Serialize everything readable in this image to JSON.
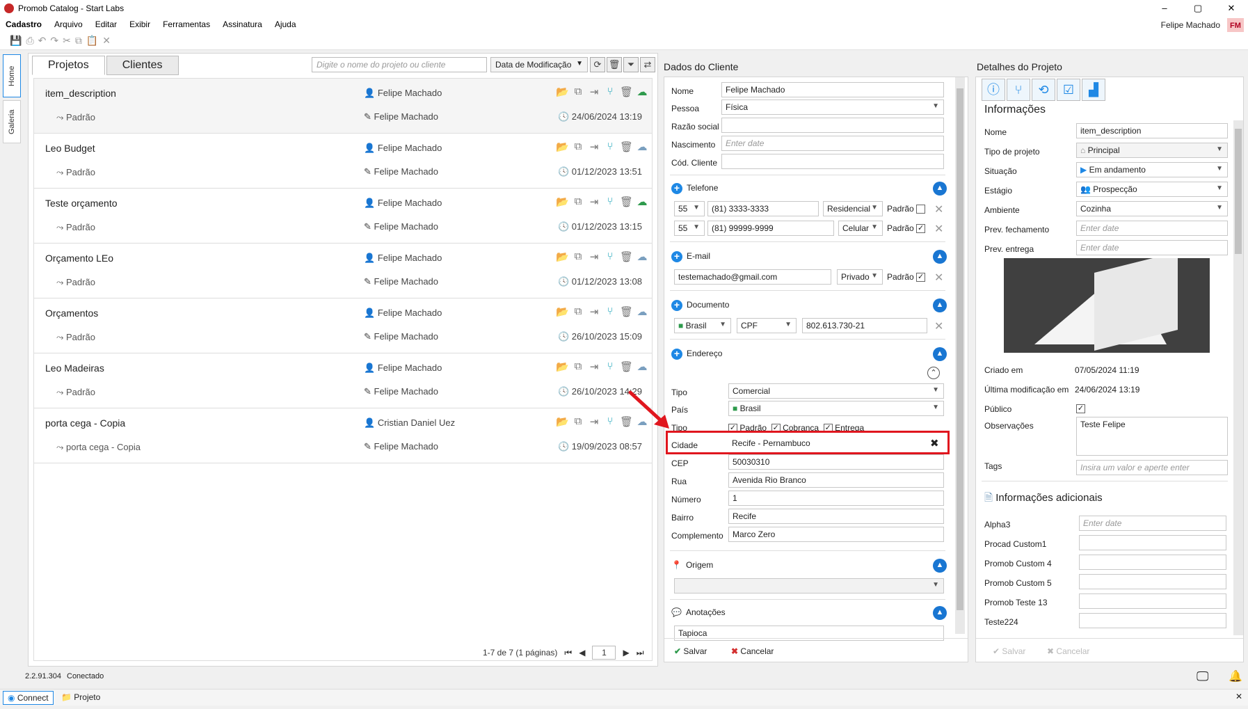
{
  "window": {
    "title": "Promob Catalog - Start Labs",
    "min": "–",
    "max": "▢",
    "close": "✕"
  },
  "menu": [
    "Cadastro",
    "Arquivo",
    "Editar",
    "Exibir",
    "Ferramentas",
    "Assinatura",
    "Ajuda"
  ],
  "user": {
    "name": "Felipe Machado",
    "initials": "FM"
  },
  "sidetabs": [
    "Home",
    "Galeria"
  ],
  "tabs": [
    "Projetos",
    "Clientes"
  ],
  "search": {
    "placeholder": "Digite o nome do projeto ou cliente"
  },
  "sort": {
    "value": "Data de Modificação"
  },
  "projects": [
    {
      "name": "item_description",
      "variant": "Padrão",
      "user": "Felipe Machado",
      "modified_by": "Felipe Machado",
      "date": "24/06/2024 13:19",
      "cloud": "green"
    },
    {
      "name": "Leo Budget",
      "variant": "Padrão",
      "user": "Felipe Machado",
      "modified_by": "Felipe Machado",
      "date": "01/12/2023 13:51",
      "cloud": "blue"
    },
    {
      "name": "Teste orçamento",
      "variant": "Padrão",
      "user": "Felipe Machado",
      "modified_by": "Felipe Machado",
      "date": "01/12/2023 13:15",
      "cloud": "green"
    },
    {
      "name": "Orçamento LEo",
      "variant": "Padrão",
      "user": "Felipe Machado",
      "modified_by": "Felipe Machado",
      "date": "01/12/2023 13:08",
      "cloud": "blue"
    },
    {
      "name": "Orçamentos",
      "variant": "Padrão",
      "user": "Felipe Machado",
      "modified_by": "Felipe Machado",
      "date": "26/10/2023 15:09",
      "cloud": "blue"
    },
    {
      "name": "Leo Madeiras",
      "variant": "Padrão",
      "user": "Felipe Machado",
      "modified_by": "Felipe Machado",
      "date": "26/10/2023 14:29",
      "cloud": "blue"
    },
    {
      "name": "porta cega - Copia",
      "variant": "porta cega - Copia",
      "user": "Cristian Daniel Uez",
      "modified_by": "Felipe Machado",
      "date": "19/09/2023 08:57",
      "cloud": "blue"
    }
  ],
  "pager": {
    "summary": "1-7 de 7 (1 páginas)",
    "page": "1"
  },
  "client": {
    "header": "Dados do Cliente",
    "labels": {
      "nome": "Nome",
      "pessoa": "Pessoa",
      "razao": "Razão social",
      "nascimento": "Nascimento",
      "cod": "Cód. Cliente"
    },
    "nome": "Felipe Machado",
    "pessoa": "Física",
    "nascimento_ph": "Enter date",
    "telefone": {
      "title": "Telefone",
      "rows": [
        {
          "ddi": "55",
          "num": "(81) 3333-3333",
          "tipo": "Residencial",
          "padrao": "Padrão",
          "checked": ""
        },
        {
          "ddi": "55",
          "num": "(81) 99999-9999",
          "tipo": "Celular",
          "padrao": "Padrão",
          "checked": "✓"
        }
      ]
    },
    "email": {
      "title": "E-mail",
      "value": "testemachado@gmail.com",
      "tipo": "Privado",
      "padrao": "Padrão",
      "checked": "✓"
    },
    "documento": {
      "title": "Documento",
      "pais": "Brasil",
      "tipo": "CPF",
      "value": "802.613.730-21"
    },
    "endereco": {
      "title": "Endereço",
      "labels": {
        "tipo": "Tipo",
        "pais": "País",
        "tipo2": "Tipo",
        "cidade": "Cidade",
        "cep": "CEP",
        "rua": "Rua",
        "numero": "Número",
        "bairro": "Bairro",
        "complemento": "Complemento"
      },
      "tipo": "Comercial",
      "pais": "Brasil",
      "checks": [
        "Padrão",
        "Cobrança",
        "Entrega"
      ],
      "cidade": "Recife - Pernambuco",
      "cep": "50030310",
      "rua": "Avenida Rio Branco",
      "numero": "1",
      "bairro": "Recife",
      "complemento": "Marco Zero"
    },
    "origem": {
      "title": "Origem"
    },
    "anotacoes": {
      "title": "Anotações",
      "value": "Tapioca"
    },
    "salvar": "Salvar",
    "cancelar": "Cancelar"
  },
  "details": {
    "header": "Detalhes do Projeto",
    "section": "Informações",
    "labels": {
      "nome": "Nome",
      "tipo": "Tipo de projeto",
      "situacao": "Situação",
      "estagio": "Estágio",
      "ambiente": "Ambiente",
      "prevf": "Prev. fechamento",
      "preve": "Prev. entrega",
      "criado": "Criado em",
      "ultima": "Última modificação em",
      "publico": "Público",
      "obs": "Observações",
      "tags": "Tags"
    },
    "nome": "item_description",
    "tipo": "Principal",
    "situacao": "Em andamento",
    "estagio": "Prospecção",
    "ambiente": "Cozinha",
    "date_ph": "Enter date",
    "criado": "07/05/2024 11:19",
    "ultima": "24/06/2024 13:19",
    "obs": "Teste Felipe",
    "tags_ph": "Insira um valor e aperte enter",
    "adicionais": "Informações adicionais",
    "extra": [
      "Alpha3",
      "Procad Custom1",
      "Promob Custom 4",
      "Promob Custom 5",
      "Promob Teste 13",
      "Teste224"
    ],
    "salvar": "Salvar",
    "cancelar": "Cancelar"
  },
  "status": {
    "version": "2.2.91.304",
    "conn": "Conectado"
  },
  "taskbar": {
    "connect": "Connect",
    "projeto": "Projeto"
  }
}
